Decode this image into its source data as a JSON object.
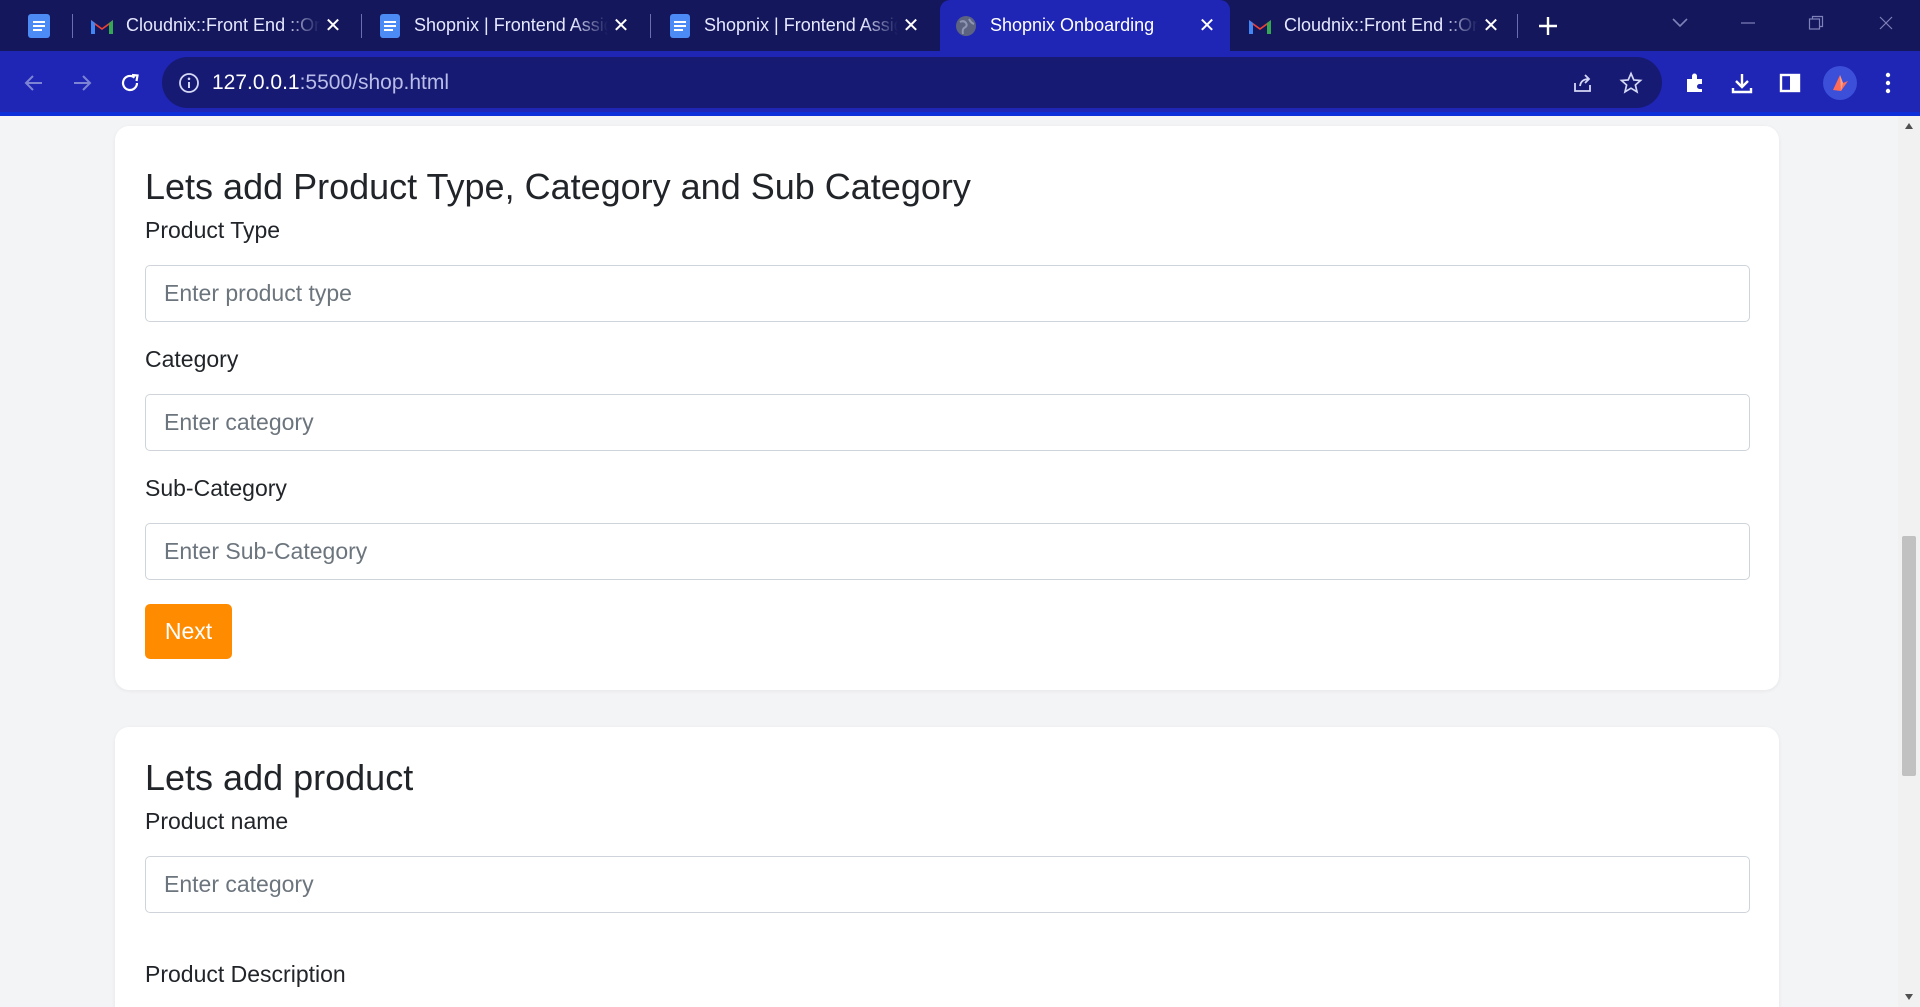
{
  "browser": {
    "tabs": [
      {
        "title": "Cloudnix::Front End ::Onboarding",
        "favicon": "gmail-icon",
        "active": false
      },
      {
        "title": "Shopnix | Frontend Assignment",
        "favicon": "docs-icon",
        "active": false
      },
      {
        "title": "Shopnix | Frontend Assignment",
        "favicon": "docs-icon",
        "active": false
      },
      {
        "title": "Shopnix Onboarding",
        "favicon": "globe-icon",
        "active": true
      },
      {
        "title": "Cloudnix::Front End ::Onboarding",
        "favicon": "gmail-icon",
        "active": false
      }
    ],
    "url": {
      "host": "127.0.0.1",
      "path": ":5500/shop.html"
    },
    "theme": {
      "tabstrip": "#14175c",
      "toolbar": "#1f25b4",
      "omnibox": "#161a73"
    }
  },
  "sections": {
    "type_category": {
      "heading": "Lets add Product Type, Category and Sub Category",
      "product_type_label": "Product Type",
      "product_type_placeholder": "Enter product type",
      "category_label": "Category",
      "category_placeholder": "Enter category",
      "subcategory_label": "Sub-Category",
      "subcategory_placeholder": "Enter Sub-Category",
      "next_label": "Next"
    },
    "add_product": {
      "heading": "Lets add product",
      "product_name_label": "Product name",
      "product_name_placeholder": "Enter category",
      "product_description_label": "Product Description"
    }
  },
  "colors": {
    "accent": "#ff8c00",
    "page_bg": "#f3f4f6",
    "card_bg": "#ffffff"
  }
}
